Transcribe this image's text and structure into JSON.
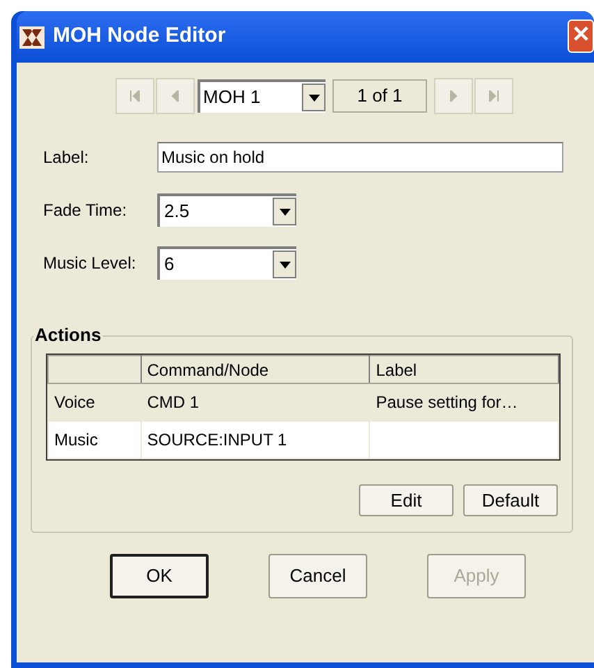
{
  "window": {
    "title": "MOH Node Editor",
    "close": "✕"
  },
  "navigator": {
    "buttons": [
      {
        "kind": "first",
        "disabled": true
      },
      {
        "kind": "prev",
        "disabled": true
      },
      {
        "kind": "next",
        "disabled": true
      },
      {
        "kind": "last",
        "disabled": true
      }
    ],
    "node": "MOH 1",
    "position": "1 of 1"
  },
  "fields": [
    {
      "kind": "text",
      "label": "Label:",
      "value": "Music on hold"
    },
    {
      "kind": "combo",
      "label": "Fade Time:",
      "value": "2.5"
    },
    {
      "kind": "combo",
      "label": "Music Level:",
      "value": "6"
    }
  ],
  "actions": {
    "title": "Actions",
    "columns": [
      "",
      "Command/Node",
      "Label"
    ],
    "rows": [
      {
        "cells": [
          "Voice",
          "CMD 1",
          "Pause setting for…"
        ],
        "selected": true
      },
      {
        "cells": [
          "Music",
          "SOURCE:INPUT 1",
          ""
        ],
        "selected": false
      }
    ],
    "buttons": [
      {
        "label": "Edit",
        "disabled": false
      },
      {
        "label": "Default",
        "disabled": false
      }
    ]
  },
  "buttons": [
    {
      "label": "OK",
      "default": true,
      "disabled": false
    },
    {
      "label": "Cancel",
      "default": false,
      "disabled": false
    },
    {
      "label": "Apply",
      "default": false,
      "disabled": true
    }
  ]
}
